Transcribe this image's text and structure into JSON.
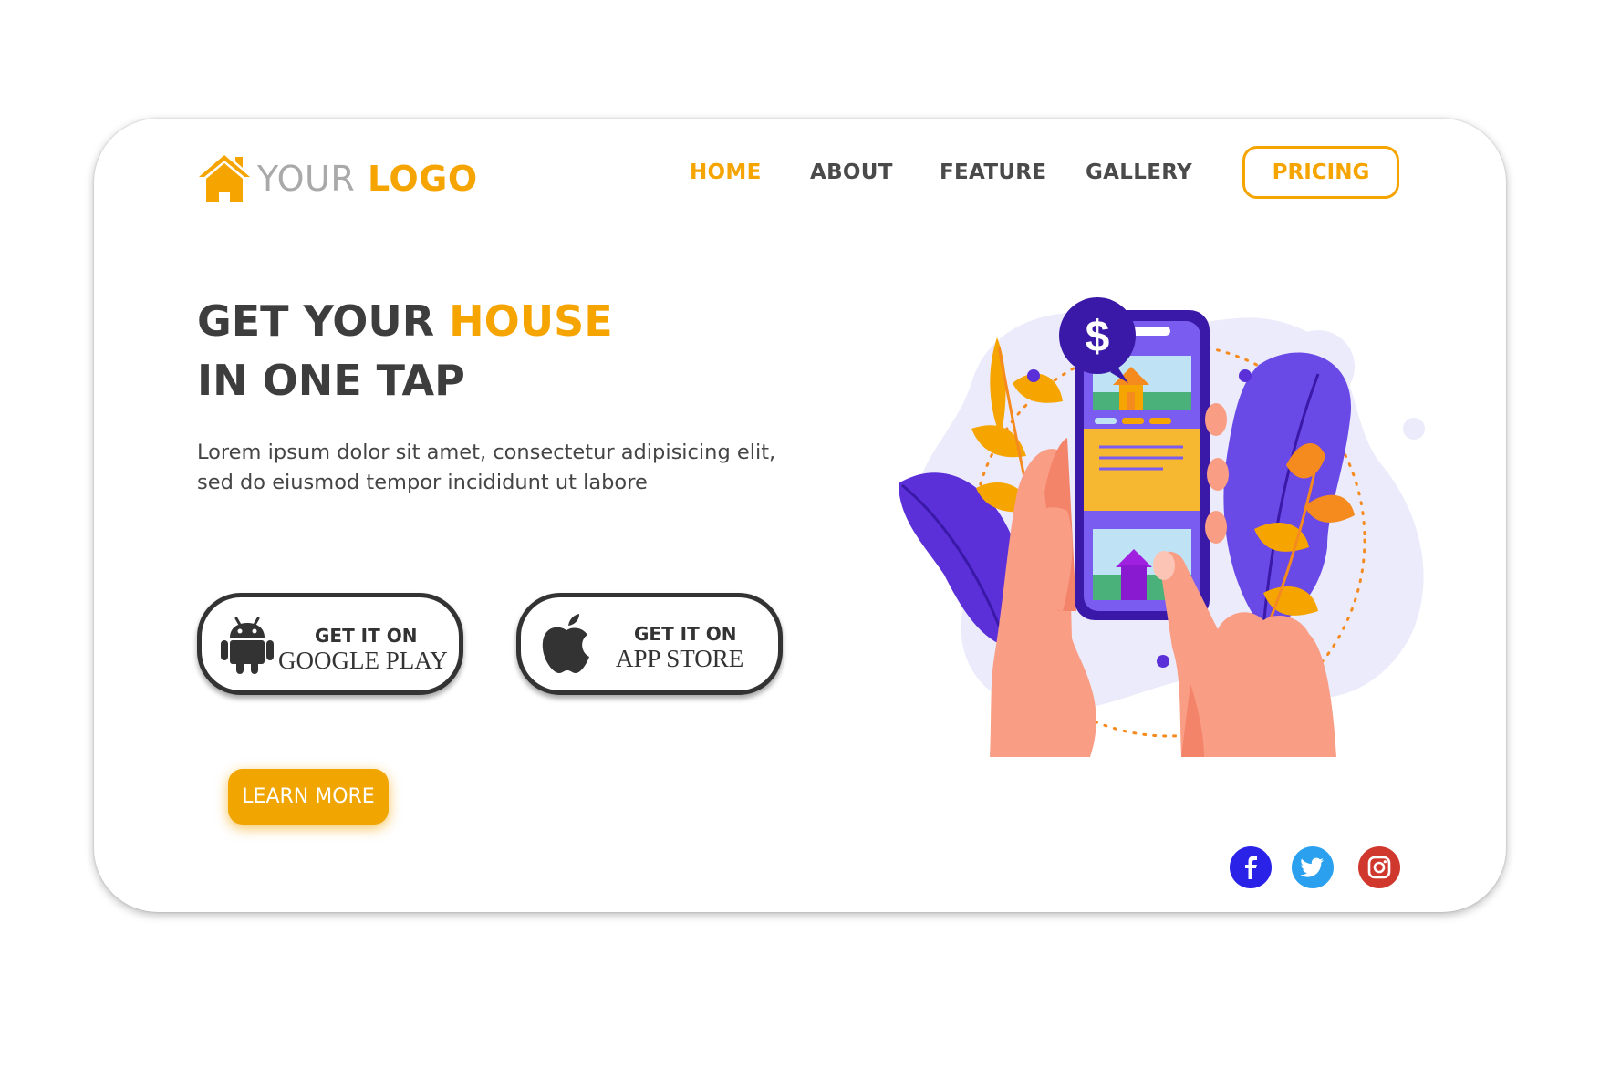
{
  "logo": {
    "part1": "YOUR",
    "part2": "LOGO",
    "icon": "house-icon"
  },
  "nav": {
    "home": "HOME",
    "about": "ABOUT",
    "feature": "FEATURE",
    "gallery": "GALLERY",
    "pricing": "PRICING"
  },
  "hero": {
    "title_part1": "GET YOUR ",
    "title_accent": "HOUSE",
    "title_line2": "IN ONE TAP",
    "description_line1": "Lorem ipsum dolor sit amet, consectetur adipisicing elit,",
    "description_line2": "sed do eiusmod tempor incididunt ut labore"
  },
  "store_buttons": {
    "google": {
      "small": "GET IT ON",
      "big": "GOOGLE PLAY",
      "icon": "android-icon"
    },
    "apple": {
      "small": "GET IT ON",
      "big": "APP STORE",
      "icon": "apple-icon"
    }
  },
  "cta": {
    "learn_more": "LEARN MORE"
  },
  "social": [
    {
      "name": "facebook-icon",
      "color": "#2b22e8"
    },
    {
      "name": "twitter-icon",
      "color": "#2aa0ef"
    },
    {
      "name": "instagram-icon",
      "color": "#d0382d"
    }
  ],
  "colors": {
    "accent": "#f5a400",
    "text": "#3d3d3d",
    "purple": "#5b3fe0"
  }
}
